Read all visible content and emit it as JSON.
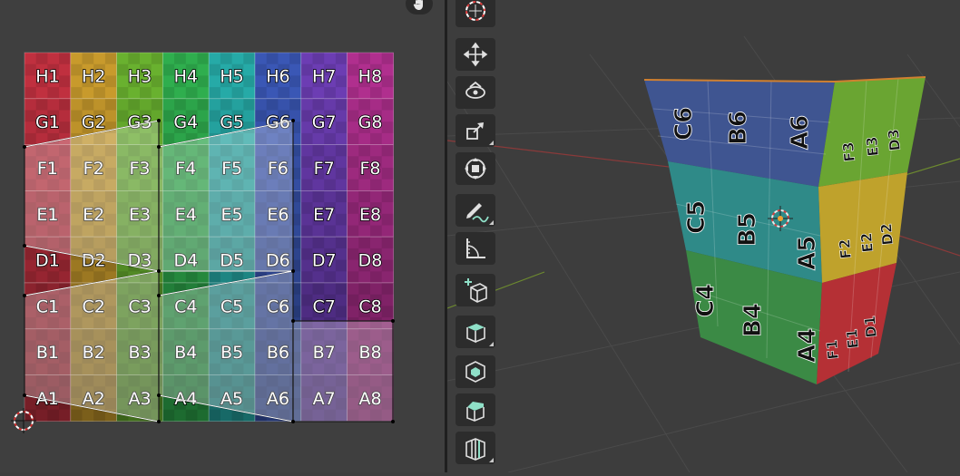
{
  "uv_editor": {
    "grid_rows": [
      "H",
      "G",
      "F",
      "E",
      "D",
      "C",
      "B",
      "A"
    ],
    "grid_cols": [
      1,
      2,
      3,
      4,
      5,
      6,
      7,
      8
    ],
    "column_colors": [
      "#c0303f",
      "#c89a2c",
      "#69b12f",
      "#2fae4e",
      "#26aaa7",
      "#3a57b5",
      "#6c3db3",
      "#b02f8e"
    ],
    "cells": [
      [
        "H1",
        "H2",
        "H3",
        "H4",
        "H5",
        "H6",
        "H7",
        "H8"
      ],
      [
        "G1",
        "G2",
        "G3",
        "G4",
        "G5",
        "G6",
        "G7",
        "G8"
      ],
      [
        "F1",
        "F2",
        "F3",
        "F4",
        "F5",
        "F6",
        "F7",
        "F8"
      ],
      [
        "E1",
        "E2",
        "E3",
        "E4",
        "E5",
        "E6",
        "E7",
        "E8"
      ],
      [
        "D1",
        "D2",
        "D3",
        "D4",
        "D5",
        "D6",
        "D7",
        "D8"
      ],
      [
        "C1",
        "C2",
        "C3",
        "C4",
        "C5",
        "C6",
        "C7",
        "C8"
      ],
      [
        "B1",
        "B2",
        "B3",
        "B4",
        "B5",
        "B6",
        "B7",
        "B8"
      ],
      [
        "A1",
        "A2",
        "A3",
        "A4",
        "A5",
        "A6",
        "A7",
        "A8"
      ]
    ]
  },
  "toolbar": {
    "tools": [
      {
        "name": "cursor-tool",
        "icon": "3d-cursor-icon"
      },
      {
        "name": "move-tool",
        "icon": "move-icon"
      },
      {
        "name": "rotate-tool",
        "icon": "rotate-icon"
      },
      {
        "name": "scale-tool",
        "icon": "scale-icon"
      },
      {
        "name": "transform-tool",
        "icon": "transform-icon"
      },
      {
        "name": "annotate-tool",
        "icon": "annotate-icon"
      },
      {
        "name": "measure-tool",
        "icon": "measure-icon"
      },
      {
        "name": "add-cube-tool",
        "icon": "add-cube-icon"
      },
      {
        "name": "extrude-tool",
        "icon": "extrude-icon"
      },
      {
        "name": "inset-tool",
        "icon": "inset-icon"
      },
      {
        "name": "bevel-tool",
        "icon": "bevel-icon"
      },
      {
        "name": "loop-cut-tool",
        "icon": "loop-cut-icon"
      }
    ]
  },
  "viewport": {
    "object_faces": {
      "front_top": [
        "C6",
        "B6",
        "A6"
      ],
      "front_mid": [
        "C5",
        "B5",
        "A5"
      ],
      "front_bottom": [
        "C4",
        "B4",
        "A4"
      ],
      "side_top": [
        "F3",
        "E3",
        "D3"
      ],
      "side_mid": [
        "F2",
        "E2",
        "D2"
      ],
      "side_bottom": [
        "F1",
        "E1",
        "D1"
      ]
    },
    "face_colors": {
      "front_top": "#3f5591",
      "front_mid": "#2f8a88",
      "front_bottom": "#3b8a45",
      "side_top": "#6aa532",
      "side_mid": "#bfa22c",
      "side_bottom": "#b53035"
    }
  }
}
